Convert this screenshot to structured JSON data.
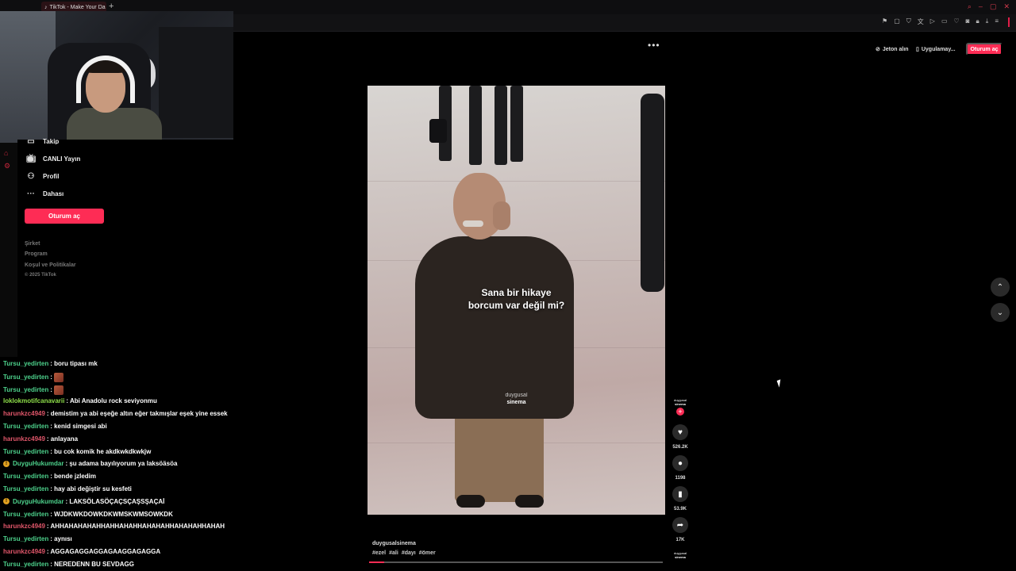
{
  "browser": {
    "tab_title": "TikTok - Make Your Da",
    "new_tab_icon": "plus-icon"
  },
  "sidebar": {
    "partial_item": "Takip",
    "items": [
      {
        "label": "CANLI Yayın",
        "icon": "live-icon"
      },
      {
        "label": "Profil",
        "icon": "profile-icon"
      },
      {
        "label": "Dahası",
        "icon": "more-icon"
      }
    ],
    "login_label": "Oturum aç",
    "footer": [
      "Şirket",
      "Program",
      "Koşul ve Politikalar",
      "© 2025 TikTok"
    ]
  },
  "chat": [
    {
      "user": "Tursu_yedirten",
      "color": "#4dd28c",
      "text": ": boru tipası mk",
      "badge": false,
      "emote": false
    },
    {
      "user": "Tursu_yedirten",
      "color": "#4dd28c",
      "text": ":",
      "badge": false,
      "emote": true
    },
    {
      "user": "Tursu_yedirten",
      "color": "#4dd28c",
      "text": ":",
      "badge": false,
      "emote": true
    },
    {
      "user": "loklokmotifcanavarii",
      "color": "#8fe04a",
      "text": ": Abi Anadolu rock seviyonmu",
      "badge": false,
      "emote": false
    },
    {
      "user": "harunkzc4949",
      "color": "#e0566a",
      "text": ": demistim ya abi eşeğe altın eğer takmışlar eşek yine essek",
      "badge": false,
      "emote": false
    },
    {
      "user": "Tursu_yedirten",
      "color": "#4dd28c",
      "text": ": kenid simgesi abi",
      "badge": false,
      "emote": false
    },
    {
      "user": "harunkzc4949",
      "color": "#e0566a",
      "text": ": anlayana",
      "badge": false,
      "emote": false
    },
    {
      "user": "Tursu_yedirten",
      "color": "#4dd28c",
      "text": ": bu cok komik he akdkwkdkwkjw",
      "badge": false,
      "emote": false
    },
    {
      "user": "DuyguHukumdar",
      "color": "#4dd28c",
      "text": ": şu adama bayılıyorum ya laksöäsöa",
      "badge": true,
      "emote": false
    },
    {
      "user": "Tursu_yedirten",
      "color": "#4dd28c",
      "text": ": bende jzledim",
      "badge": false,
      "emote": false
    },
    {
      "user": "Tursu_yedirten",
      "color": "#4dd28c",
      "text": ": hay abi değiştir su kesfeti",
      "badge": false,
      "emote": false
    },
    {
      "user": "DuyguHukumdar",
      "color": "#4dd28c",
      "text": ": LAKSÖLASÖÇAÇSÇAŞSŞAÇAİ",
      "badge": true,
      "emote": false
    },
    {
      "user": "Tursu_yedirten",
      "color": "#4dd28c",
      "text": ": WJDKWKDOWKDKWMSKWMSOWKDK",
      "badge": false,
      "emote": false
    },
    {
      "user": "harunkzc4949",
      "color": "#e0566a",
      "text": ": AHHAHAHAHAHHAHHAHAHHAHAHAHHAHAHAHHAHAH",
      "badge": false,
      "emote": false
    },
    {
      "user": "Tursu_yedirten",
      "color": "#4dd28c",
      "text": ": aynısı",
      "badge": false,
      "emote": false
    },
    {
      "user": "harunkzc4949",
      "color": "#e0566a",
      "text": ": AGGAGAGGAGGAGAAGGAGAGGA",
      "badge": false,
      "emote": false
    },
    {
      "user": "Tursu_yedirten",
      "color": "#4dd28c",
      "text": ": NEREDENN BU SEVDAGG",
      "badge": false,
      "emote": false
    }
  ],
  "video": {
    "caption_line1": "Sana bir hikaye",
    "caption_line2": "borcum var değil mi?",
    "watermark_line1": "duygusal",
    "watermark_line2": "sinema",
    "author": "duygusalsinema",
    "hashtags": [
      "#ezel",
      "#ali",
      "#dayı",
      "#ömer"
    ],
    "progress": 0.05,
    "accent": "#fe2c55"
  },
  "actions": {
    "avatar_line1": "duygusal",
    "avatar_line2": "sinema",
    "like_count": "526.2K",
    "comment_count": "1198",
    "save_count": "53.9K",
    "share_count": "17K"
  },
  "topbar": {
    "coins_label": "Jeton alın",
    "app_label": "Uygulamay...",
    "login_label": "Oturum aç"
  }
}
